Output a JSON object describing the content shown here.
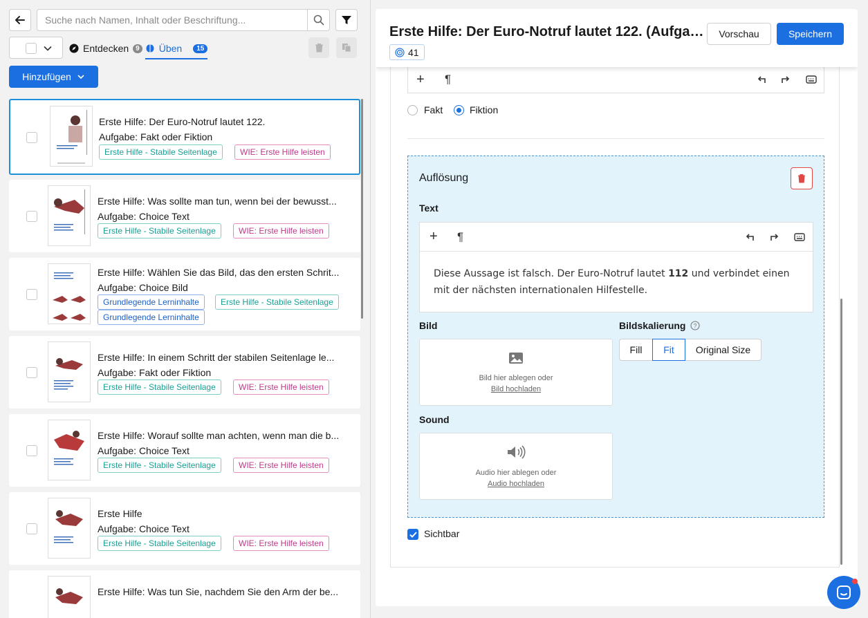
{
  "left": {
    "search": {
      "placeholder": "Suche nach Namen, Inhalt oder Beschriftung..."
    },
    "tabs": [
      {
        "label": "Entdecken",
        "count": "9"
      },
      {
        "label": "Üben",
        "count": "15"
      }
    ],
    "add_button": "Hinzufügen",
    "cards": [
      {
        "title": "Erste Hilfe: Der Euro-Notruf lautet 122.",
        "subtitle": "Aufgabe: Fakt oder Fiktion",
        "tags": [
          "Erste Hilfe - Stabile Seitenlage",
          "WIE: Erste Hilfe leisten"
        ]
      },
      {
        "title": "Erste Hilfe: Was sollte man tun, wenn bei der bewusst...",
        "subtitle": "Aufgabe: Choice Text",
        "tags": [
          "Erste Hilfe - Stabile Seitenlage",
          "WIE: Erste Hilfe leisten"
        ]
      },
      {
        "title": "Erste Hilfe: Wählen Sie das Bild, das den ersten Schrit...",
        "subtitle": "Aufgabe: Choice Bild",
        "tags": [
          "Grundlegende Lerninhalte",
          "Erste Hilfe - Stabile Seitenlage",
          "Grundlegende Lerninhalte"
        ]
      },
      {
        "title": "Erste Hilfe: In einem Schritt der stabilen Seitenlage le...",
        "subtitle": "Aufgabe: Fakt oder Fiktion",
        "tags": [
          "Erste Hilfe - Stabile Seitenlage",
          "WIE: Erste Hilfe leisten"
        ]
      },
      {
        "title": "Erste Hilfe: Worauf sollte man achten, wenn man die b...",
        "subtitle": "Aufgabe: Choice Text",
        "tags": [
          "Erste Hilfe - Stabile Seitenlage",
          "WIE: Erste Hilfe leisten"
        ]
      },
      {
        "title": "Erste Hilfe",
        "subtitle": "Aufgabe: Choice Text",
        "tags": [
          "Erste Hilfe - Stabile Seitenlage",
          "WIE: Erste Hilfe leisten"
        ]
      },
      {
        "title": "Erste Hilfe: Was tun Sie, nachdem Sie den Arm der be...",
        "subtitle": "",
        "tags": []
      }
    ]
  },
  "right": {
    "title": "Erste Hilfe: Der Euro-Notruf lautet 122. (Aufgabe...",
    "badge_count": "41",
    "preview_button": "Vorschau",
    "save_button": "Speichern",
    "answer": {
      "option_fact": "Fakt",
      "option_fiction": "Fiktion",
      "selected": "Fiktion"
    },
    "resolution": {
      "heading": "Auflösung",
      "text_label": "Text",
      "body_pre": "Diese Aussage ist falsch. Der Euro-Notruf lautet ",
      "body_bold": "112",
      "body_post": " und verbindet einen mit der nächsten internationalen Hilfestelle.",
      "image_label": "Bild",
      "image_drop": "Bild hier ablegen oder",
      "image_upload": "Bild hochladen",
      "scaling_label": "Bildskalierung",
      "scaling_options": [
        "Fill",
        "Fit",
        "Original Size"
      ],
      "scaling_selected": "Fit",
      "sound_label": "Sound",
      "audio_drop": "Audio hier ablegen oder",
      "audio_upload": "Audio hochladen"
    },
    "visible_label": "Sichtbar",
    "visible_checked": true
  },
  "colors": {
    "accent": "#1b6fe0",
    "teal": "#1a9f93",
    "pink": "#c0388a",
    "danger": "#e04848"
  }
}
